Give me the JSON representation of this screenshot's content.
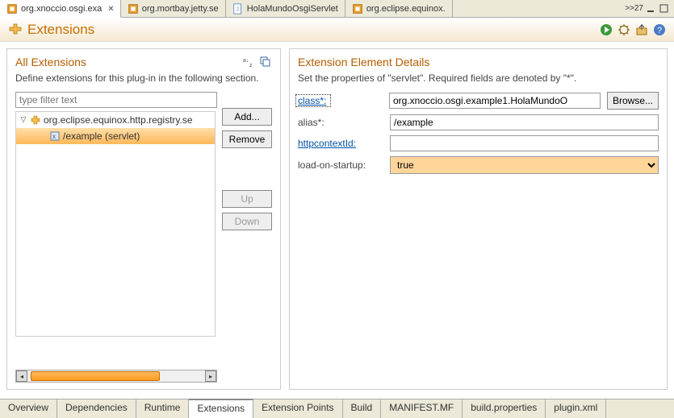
{
  "topTabs": [
    {
      "label": "org.xnoccio.osgi.exa",
      "active": true,
      "hasClose": true
    },
    {
      "label": "org.mortbay.jetty.se"
    },
    {
      "label": "HolaMundoOsgiServlet"
    },
    {
      "label": "org.eclipse.equinox."
    }
  ],
  "overflowIndicator": ">>27",
  "header": {
    "title": "Extensions"
  },
  "leftPanel": {
    "title": "All Extensions",
    "desc": "Define extensions for this plug-in in the following section.",
    "filterPlaceholder": "type filter text",
    "tree": [
      {
        "label": "org.eclipse.equinox.http.registry.se",
        "kind": "ext"
      },
      {
        "label": "/example (servlet)",
        "kind": "child",
        "selected": true
      }
    ],
    "buttons": {
      "add": "Add...",
      "remove": "Remove",
      "up": "Up",
      "down": "Down"
    }
  },
  "rightPanel": {
    "title": "Extension Element Details",
    "desc": "Set the properties of \"servlet\". Required fields are denoted by \"*\".",
    "fields": {
      "classLabel": "class*:",
      "classValue": "org.xnoccio.osgi.example1.HolaMundoO",
      "browse": "Browse...",
      "aliasLabel": "alias*:",
      "aliasValue": "/example",
      "httpctxLabel": "httpcontextId:",
      "httpctxValue": "",
      "loadLabel": "load-on-startup:",
      "loadValue": "true"
    }
  },
  "bottomTabs": [
    "Overview",
    "Dependencies",
    "Runtime",
    "Extensions",
    "Extension Points",
    "Build",
    "MANIFEST.MF",
    "build.properties",
    "plugin.xml"
  ],
  "bottomActive": 3
}
